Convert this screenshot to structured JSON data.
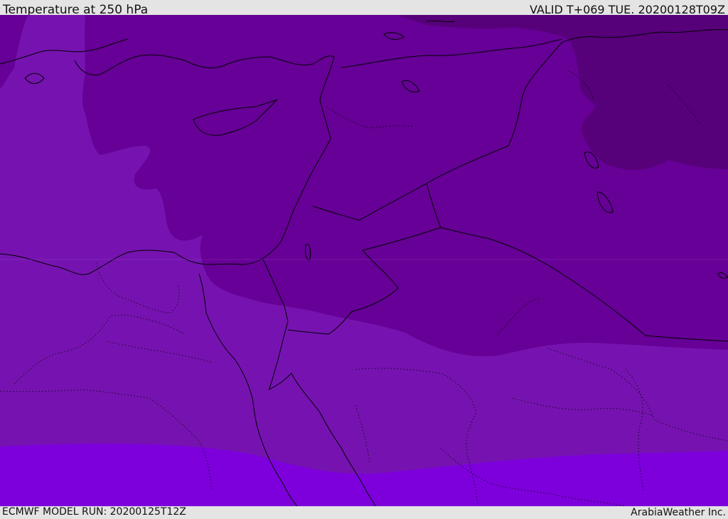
{
  "header": {
    "title": "Temperature at 250 hPa",
    "valid_time": "VALID T+069 TUE. 20200128T09Z"
  },
  "footer": {
    "model_run": "ECMWF MODEL RUN: 20200125T12Z",
    "credit": "ArabiaWeather Inc."
  },
  "colors": {
    "coldest": "#56007a",
    "colder": "#660096",
    "cold": "#7613b0",
    "mild": "#7d00dc",
    "borders": "#000000",
    "frame": "#e4e4e4"
  }
}
